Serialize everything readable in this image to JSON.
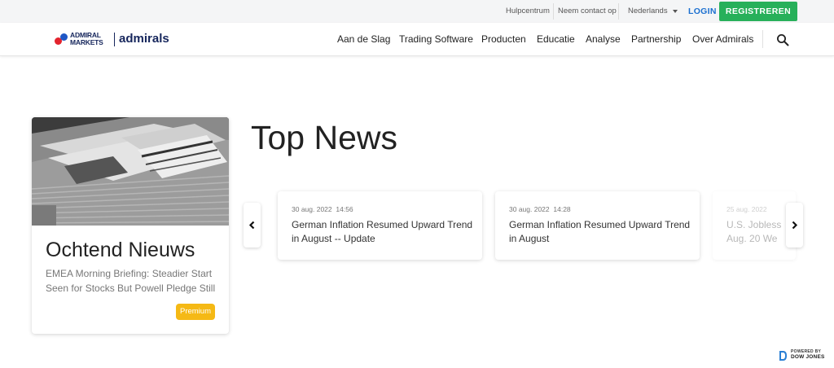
{
  "topbar": {
    "help": "Hulpcentrum",
    "contact": "Neem contact op",
    "language": "Nederlands",
    "login": "LOGIN",
    "register": "REGISTREREN"
  },
  "logo": {
    "line1": "ADMIRAL",
    "line2": "MARKETS",
    "brand": "admirals"
  },
  "nav": {
    "items": [
      "Aan de Slag",
      "Trading Software",
      "Producten",
      "Educatie",
      "Analyse",
      "Partnership",
      "Over Admirals"
    ]
  },
  "morning_card": {
    "title": "Ochtend Nieuws",
    "description": "EMEA Morning Briefing: Steadier Start Seen for Stocks But Powell Pledge Still",
    "badge": "Premium"
  },
  "top_news": {
    "title": "Top News",
    "slides": [
      {
        "date": "30 aug. 2022",
        "time": "14:56",
        "headline": "German Inflation Resumed Upward Trend in August -- Update"
      },
      {
        "date": "30 aug. 2022",
        "time": "14:28",
        "headline": "German Inflation Resumed Upward Trend in August"
      },
      {
        "date": "25 aug. 2022",
        "time": "",
        "headline": "U.S. Jobless Aug. 20 We"
      }
    ]
  },
  "footer": {
    "powered_by": "POWERED BY",
    "provider": "DOW JONES"
  },
  "colors": {
    "accent_blue": "#1a6fd0",
    "register_green": "#27b05a",
    "premium_yellow": "#f5b915",
    "brand_navy": "#16265c"
  },
  "icons": {
    "search": "search-icon",
    "prev": "chevron-left-icon",
    "next": "chevron-right-icon",
    "language_caret": "caret-down-icon"
  }
}
